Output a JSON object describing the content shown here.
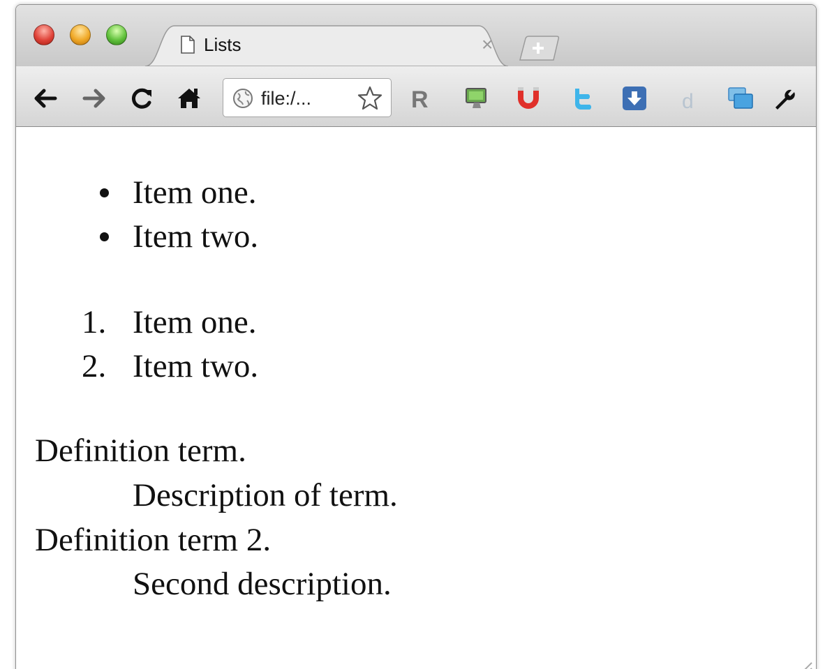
{
  "browser": {
    "tab": {
      "title": "Lists",
      "close_glyph": "×"
    },
    "new_tab_glyph": "+",
    "omnibox": {
      "url": "file:/..."
    },
    "extension_icons": [
      "r-icon",
      "monitor-icon",
      "magnet-icon",
      "twitter-icon",
      "download-icon",
      "delicious-icon",
      "screens-icon"
    ]
  },
  "page": {
    "unordered_list": [
      "Item one.",
      "Item two."
    ],
    "ordered_list": [
      {
        "marker": "1.",
        "text": "Item one."
      },
      {
        "marker": "2.",
        "text": "Item two."
      }
    ],
    "definition_list": [
      {
        "term": "Definition term.",
        "description": "Description of term."
      },
      {
        "term": "Definition term 2.",
        "description": "Second description."
      }
    ]
  },
  "colors": {
    "titlebar": "#d0d0d0",
    "toolbar": "#e0e0e0",
    "text": "#111111"
  }
}
